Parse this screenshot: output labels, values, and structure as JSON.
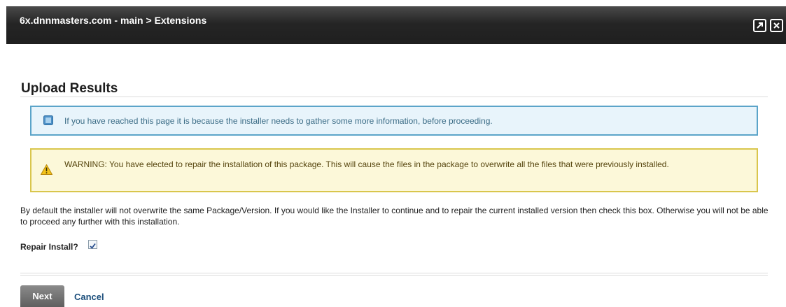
{
  "window": {
    "title": "6x.dnnmasters.com - main > Extensions",
    "buttons": [
      "maximize-icon",
      "close-icon"
    ]
  },
  "page": {
    "heading": "Upload Results",
    "info_message": "If you have reached this page it is because the installer needs to gather some more information, before proceeding.",
    "warning_message": "WARNING: You have elected to repair the installation of this package. This will cause the files in the package to overwrite all the files that were previously installed.",
    "description": "By default the installer will not overwrite the same Package/Version. If you would like the Installer to continue and to repair the current installed version then check this box. Otherwise you will not be able to proceed any further with this installation.",
    "repair_label": "Repair Install?",
    "repair_checked": true
  },
  "actions": {
    "next_label": "Next",
    "cancel_label": "Cancel"
  },
  "colors": {
    "titlebar": "#252525",
    "info_border": "#5ba4c9",
    "info_bg": "#e8f4fb",
    "warning_border": "#d9c64d",
    "warning_bg": "#fcf8d9",
    "link": "#1c4f7c"
  }
}
